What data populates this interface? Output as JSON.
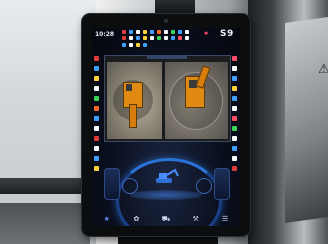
{
  "status_bar": {
    "time": "10:28",
    "date": "",
    "mode_label": "S9",
    "mode_icon": "gear-icon"
  },
  "status_icon_colors": [
    "#e23b3b",
    "#3fa0ff",
    "#ffffff",
    "#ffd23a",
    "#3fa0ff",
    "#ff6a2a",
    "#ffffff",
    "#3ad35a",
    "#3fa0ff",
    "#ffffff",
    "#e23b3b",
    "#ffffff",
    "#3fa0ff",
    "#ffd23a",
    "#ffffff",
    "#3ad35a",
    "#ffffff",
    "#3fa0ff",
    "#ff4d6a",
    "#ffffff",
    "#3fa0ff",
    "#ffffff",
    "#ffd23a",
    "#3fa0ff"
  ],
  "left_indicators": [
    "#e23b3b",
    "#3fa0ff",
    "#ffd23a",
    "#ffffff",
    "#3ad35a",
    "#ff6a2a",
    "#3fa0ff",
    "#ffffff",
    "#e23b3b",
    "#ffffff",
    "#3fa0ff",
    "#ffd23a"
  ],
  "right_indicators": [
    "#ff4d6a",
    "#ffffff",
    "#3fa0ff",
    "#ffd23a",
    "#3fa0ff",
    "#ffffff",
    "#ff4d6a",
    "#3ad35a",
    "#ffffff",
    "#3fa0ff",
    "#ffffff",
    "#e23b3b"
  ],
  "camera": {
    "tab_label": ""
  },
  "info_line": "",
  "bottom_nav": [
    {
      "icon": "home-icon",
      "glyph": "★"
    },
    {
      "icon": "settings-icon",
      "glyph": "✿"
    },
    {
      "icon": "machine-icon",
      "glyph": "⛟"
    },
    {
      "icon": "tools-icon",
      "glyph": "⚒"
    },
    {
      "icon": "menu-icon",
      "glyph": "☰"
    }
  ],
  "colors": {
    "accent": "#2a73d8",
    "mode_label": "#f1f3f8",
    "excavator": "#e08a14"
  }
}
